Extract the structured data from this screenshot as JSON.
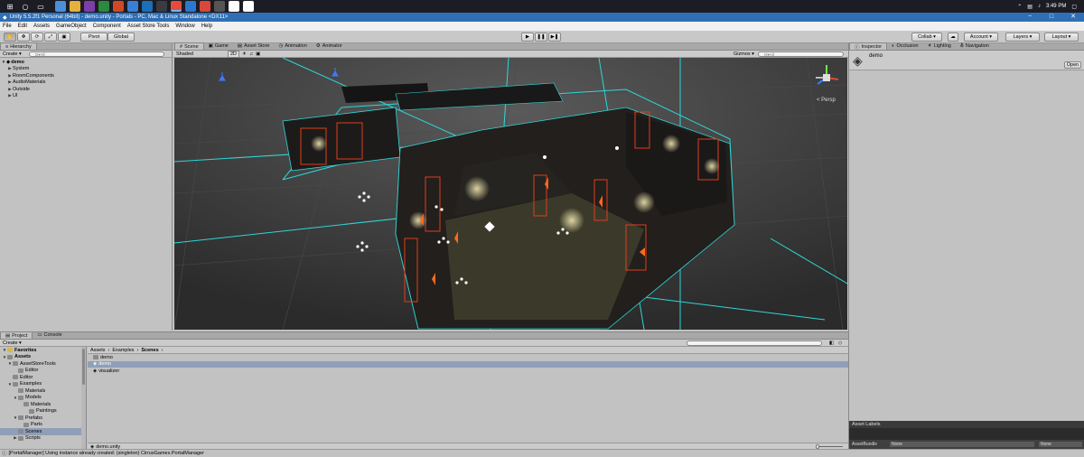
{
  "taskbar": {
    "time": "3:49 PM",
    "date": "",
    "apps": [
      "#4a90d9",
      "#e6b13a",
      "#7c3fa8",
      "#2c8a3c",
      "#d24726",
      "#3a7fd6",
      "#1a6fb8",
      "#fff2",
      "#e64c3c",
      "#2b78d0",
      "#d9483b",
      "#555",
      "#ffffff",
      "#ffffff"
    ]
  },
  "window": {
    "title": "Unity 5.5.2f1 Personal (64bit) - demo.unity - Portals - PC, Mac & Linux Standalone <DX11>",
    "min": "−",
    "max": "□",
    "close": "✕"
  },
  "menu": [
    "File",
    "Edit",
    "Assets",
    "GameObject",
    "Component",
    "Asset Store Tools",
    "Window",
    "Help"
  ],
  "toolbar": {
    "pivot": "Pivot",
    "global": "Global",
    "collab": "Collab ▾",
    "account": "Account ▾",
    "layers": "Layers ▾",
    "layout": "Layout ▾",
    "play": "▶",
    "pause": "❚❚",
    "step": "▶❚"
  },
  "hierarchy": {
    "tab": "Hierarchy",
    "create": "Create ▾",
    "search_placeholder": "Q▾All",
    "scene": "demo",
    "items": [
      "System",
      "RoomComponents",
      "AudioMaterials",
      "Outside",
      "UI"
    ]
  },
  "scene_view": {
    "tabs": [
      "Scene",
      "Game",
      "Asset Store",
      "Animation",
      "Animator"
    ],
    "shading": "Shaded",
    "mode_2d": "2D",
    "gizmos": "Gizmos ▾",
    "search_placeholder": "Q▾All",
    "persp": "< Persp"
  },
  "inspector": {
    "tabs": [
      "Inspector",
      "Occlusion",
      "Lighting",
      "Navigation"
    ],
    "object_name": "demo",
    "open_button": "Open",
    "asset_labels": "Asset Labels",
    "asset_bundle_label": "AssetBundle",
    "bundle_value": "None",
    "bundle_variant": "None"
  },
  "project": {
    "tabs": [
      "Project",
      "Console"
    ],
    "create": "Create ▾",
    "favorites": "Favorites",
    "assets": "Assets",
    "tree": [
      {
        "label": "Favorites",
        "indent": 0,
        "tri": "▼",
        "kind": "fav"
      },
      {
        "label": "Assets",
        "indent": 0,
        "tri": "▼",
        "kind": "folder"
      },
      {
        "label": "AssetStoreTools",
        "indent": 1,
        "tri": "▼",
        "kind": "folder"
      },
      {
        "label": "Editor",
        "indent": 2,
        "tri": "",
        "kind": "folder"
      },
      {
        "label": "Editor",
        "indent": 1,
        "tri": "",
        "kind": "folder"
      },
      {
        "label": "Examples",
        "indent": 1,
        "tri": "▼",
        "kind": "folder"
      },
      {
        "label": "Materials",
        "indent": 2,
        "tri": "",
        "kind": "folder"
      },
      {
        "label": "Models",
        "indent": 2,
        "tri": "▼",
        "kind": "folder"
      },
      {
        "label": "Materials",
        "indent": 3,
        "tri": "",
        "kind": "folder"
      },
      {
        "label": "Paintings",
        "indent": 4,
        "tri": "",
        "kind": "folder"
      },
      {
        "label": "Prefabs",
        "indent": 2,
        "tri": "▼",
        "kind": "folder"
      },
      {
        "label": "Parts",
        "indent": 3,
        "tri": "",
        "kind": "folder"
      },
      {
        "label": "Scenes",
        "indent": 2,
        "tri": "",
        "kind": "folder",
        "selected": true
      },
      {
        "label": "Scripts",
        "indent": 2,
        "tri": "▶",
        "kind": "folder"
      }
    ],
    "breadcrumb": [
      "Assets",
      "Examples",
      "Scenes"
    ],
    "files": [
      {
        "label": "demo",
        "kind": "folder",
        "selected": false
      },
      {
        "label": "demo",
        "kind": "unity",
        "selected": true
      },
      {
        "label": "visualizer",
        "kind": "unity",
        "selected": false
      }
    ],
    "footer_file": "demo.unity"
  },
  "status": "[PortalManager] Using instance already created: (singleton) CirrusGames.PortalManager"
}
